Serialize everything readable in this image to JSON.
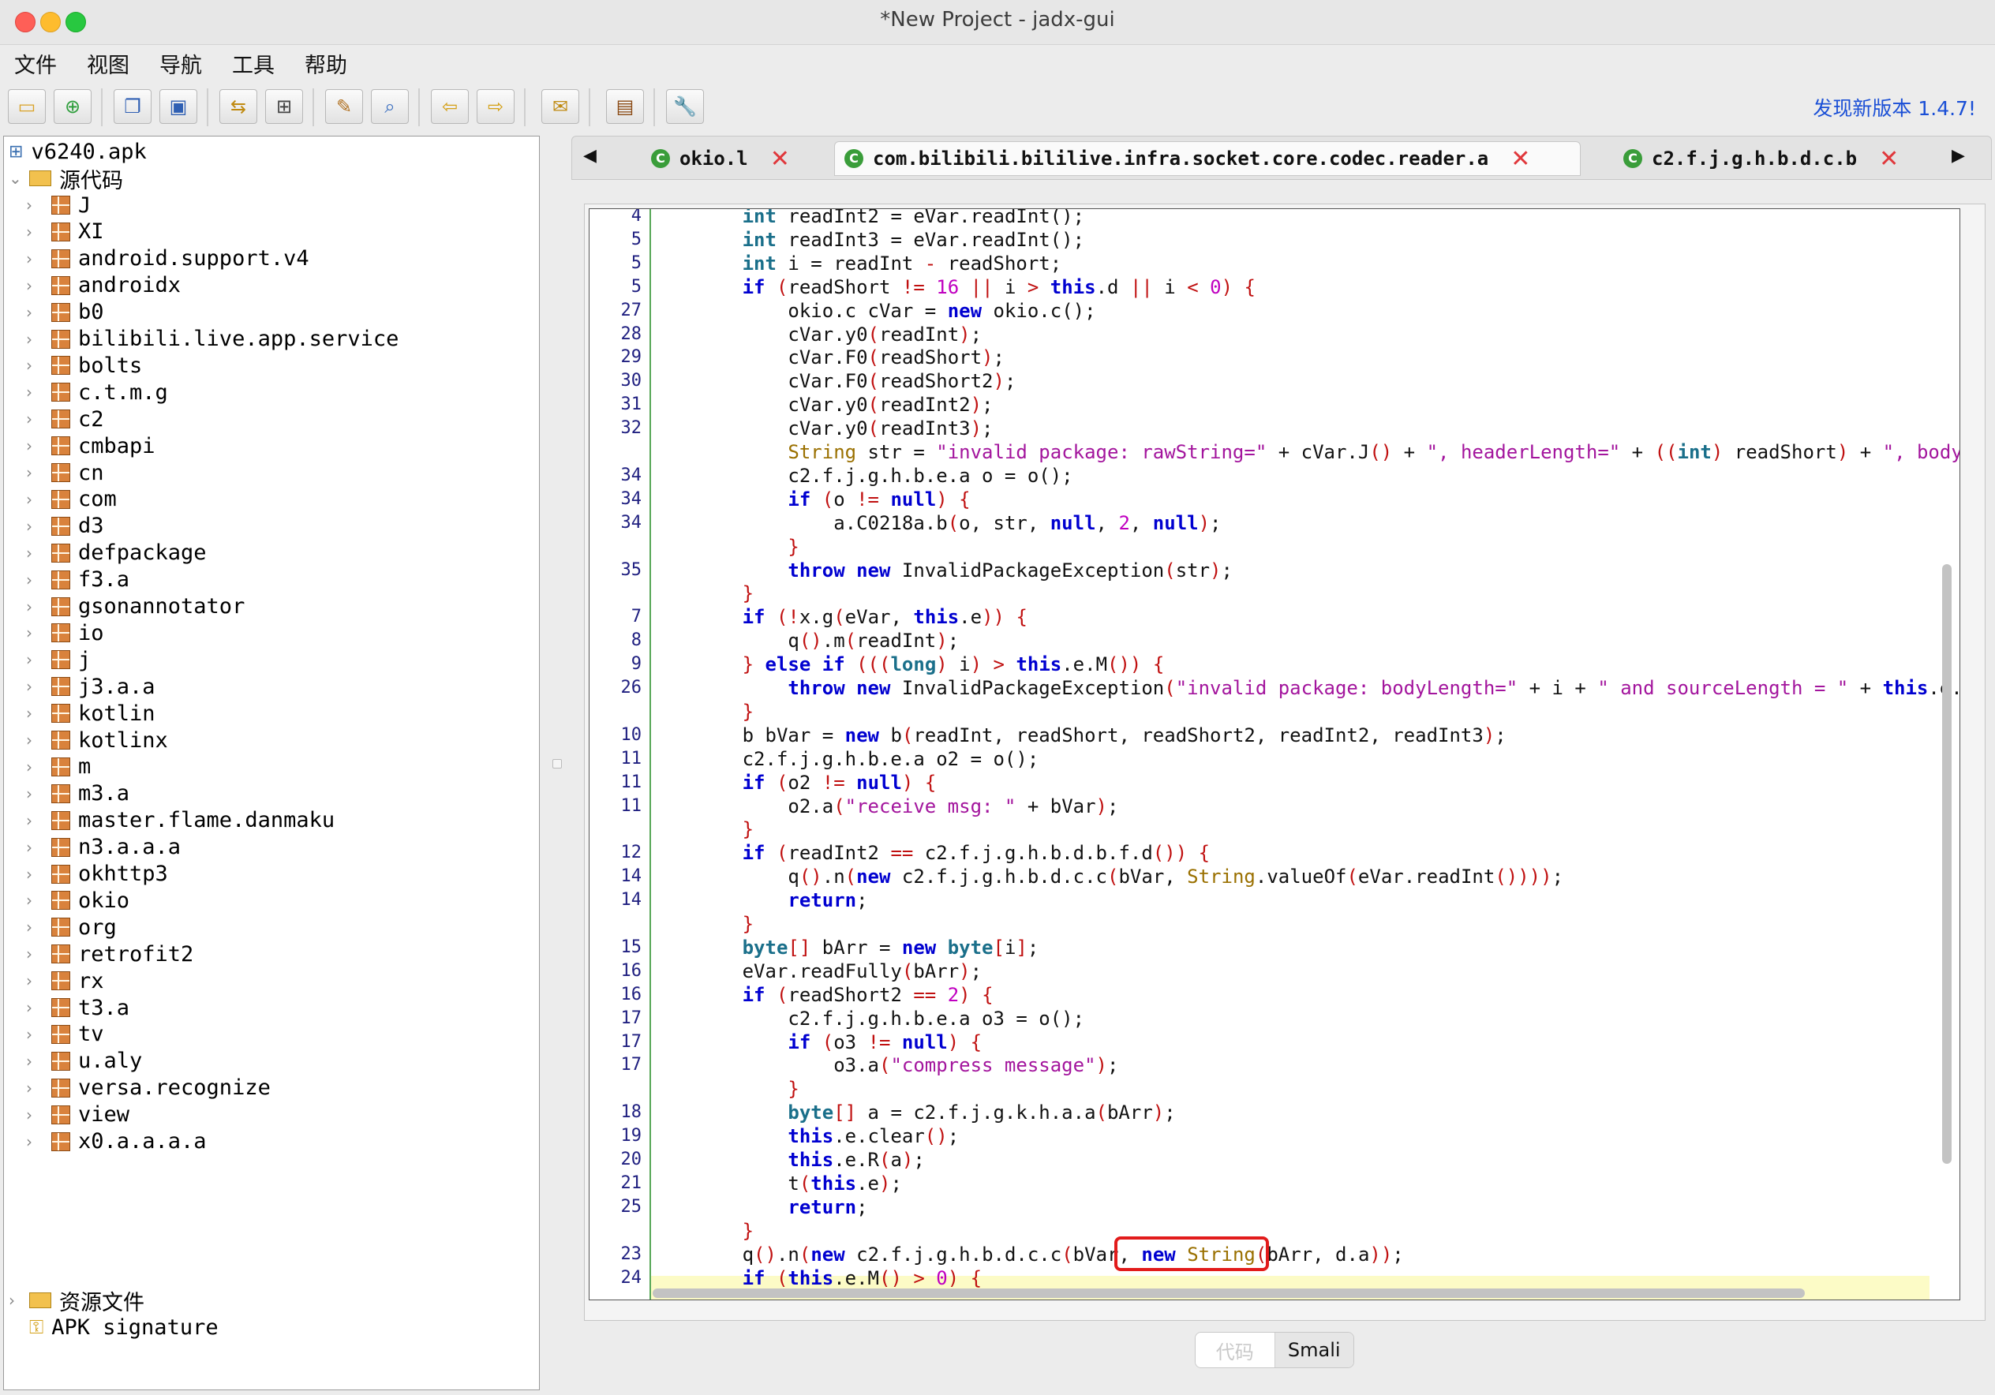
{
  "window": {
    "title": "*New Project - jadx-gui"
  },
  "menu": [
    "文件",
    "视图",
    "导航",
    "工具",
    "帮助"
  ],
  "toolbar": {
    "buttons": [
      "open-file-icon",
      "add-files-icon",
      "copy-icon",
      "save-all-icon",
      "sync-icon",
      "flatten-icon",
      "decompile-wand-icon",
      "search-icon",
      "back-arrow-icon",
      "forward-arrow-icon",
      "preferences-icon",
      "log-viewer-icon",
      "settings-wrench-icon"
    ],
    "update_text": "发现新版本 1.4.7!"
  },
  "tree": {
    "root": "v6240.apk",
    "source_folder": "源代码",
    "packages": [
      "J",
      "XI",
      "android.support.v4",
      "androidx",
      "b0",
      "bilibili.live.app.service",
      "bolts",
      "c.t.m.g",
      "c2",
      "cmbapi",
      "cn",
      "com",
      "d3",
      "defpackage",
      "f3.a",
      "gsonannotator",
      "io",
      "j",
      "j3.a.a",
      "kotlin",
      "kotlinx",
      "m",
      "m3.a",
      "master.flame.danmaku",
      "n3.a.a.a",
      "okhttp3",
      "okio",
      "org",
      "retrofit2",
      "rx",
      "t3.a",
      "tv",
      "u.aly",
      "versa.recognize",
      "view",
      "x0.a.a.a.a"
    ],
    "resources": "资源文件",
    "signature": "APK signature"
  },
  "tabs": [
    {
      "label": "okio.l",
      "icon": "class-c-icon"
    },
    {
      "label": "com.bilibili.bililive.infra.socket.core.codec.reader.a",
      "icon": "class-c-icon",
      "active": true
    },
    {
      "label": "c2.f.j.g.h.b.d.c.b",
      "icon": "class-c-icon"
    }
  ],
  "editor": {
    "line_numbers": [
      "4",
      "5",
      "5",
      "5",
      "27",
      "28",
      "29",
      "30",
      "31",
      "32",
      "",
      "34",
      "34",
      "34",
      "",
      "35",
      "",
      "7",
      "8",
      "9",
      "26",
      "",
      "10",
      "11",
      "11",
      "11",
      "",
      "12",
      "14",
      "14",
      "",
      "15",
      "16",
      "16",
      "17",
      "17",
      "17",
      "",
      "18",
      "19",
      "20",
      "21",
      "25",
      "",
      "23",
      "24"
    ],
    "lines": [
      "        <span class='ty'>int</span> readInt2 = eVar.readInt();",
      "        <span class='ty'>int</span> readInt3 = eVar.readInt();",
      "        <span class='ty'>int</span> i = readInt <span class='op'>-</span> readShort;",
      "        <span class='kw'>if</span> <span class='op'>(</span>readShort <span class='op'>!=</span> <span class='num'>16</span> <span class='op'>||</span> i <span class='op'>&gt;</span> <span class='kw'>this</span>.d <span class='op'>||</span> i <span class='op'>&lt;</span> <span class='num'>0</span><span class='op'>)</span> <span class='op'>{</span>",
      "            okio.c cVar = <span class='kw'>new</span> okio.c();",
      "            cVar.y0<span class='op'>(</span>readInt<span class='op'>)</span>;",
      "            cVar.F0<span class='op'>(</span>readShort<span class='op'>)</span>;",
      "            cVar.F0<span class='op'>(</span>readShort2<span class='op'>)</span>;",
      "            cVar.y0<span class='op'>(</span>readInt2<span class='op'>)</span>;",
      "            cVar.y0<span class='op'>(</span>readInt3<span class='op'>)</span>;",
      "            <span class='cls'>String</span> str = <span class='st'>\"invalid package: rawString=\"</span> + cVar.J<span class='op'>()</span> + <span class='st'>\", headerLength=\"</span> + <span class='op'>((</span><span class='ty'>int</span><span class='op'>)</span> readShort<span class='op'>)</span> + <span class='st'>\", bodyL</span>",
      "            c2.f.j.g.h.b.e.a o = o();",
      "            <span class='kw'>if</span> <span class='op'>(</span>o <span class='op'>!=</span> <span class='kw'>null</span><span class='op'>)</span> <span class='op'>{</span>",
      "                a.C0218a.b<span class='op'>(</span>o, str, <span class='kw'>null</span>, <span class='num'>2</span>, <span class='kw'>null</span><span class='op'>)</span>;",
      "            <span class='op'>}</span>",
      "            <span class='kw'>throw</span> <span class='kw'>new</span> InvalidPackageException<span class='op'>(</span>str<span class='op'>)</span>;",
      "        <span class='op'>}</span>",
      "        <span class='kw'>if</span> <span class='op'>(!</span>x.g<span class='op'>(</span>eVar, <span class='kw'>this</span>.e<span class='op'>))</span> <span class='op'>{</span>",
      "            q<span class='op'>()</span>.m<span class='op'>(</span>readInt<span class='op'>)</span>;",
      "        <span class='op'>}</span> <span class='kw'>else if</span> <span class='op'>(((</span><span class='ty'>long</span><span class='op'>)</span> i<span class='op'>)</span> <span class='op'>&gt;</span> <span class='kw'>this</span>.e.M<span class='op'>())</span> <span class='op'>{</span>",
      "            <span class='kw'>throw</span> <span class='kw'>new</span> InvalidPackageException<span class='op'>(</span><span class='st'>\"invalid package: bodyLength=\"</span> + i + <span class='st'>\" and sourceLength = \"</span> + <span class='kw'>this</span>.e.M",
      "        <span class='op'>}</span>",
      "        b bVar = <span class='kw'>new</span> b<span class='op'>(</span>readInt, readShort, readShort2, readInt2, readInt3<span class='op'>)</span>;",
      "        c2.f.j.g.h.b.e.a o2 = o();",
      "        <span class='kw'>if</span> <span class='op'>(</span>o2 <span class='op'>!=</span> <span class='kw'>null</span><span class='op'>)</span> <span class='op'>{</span>",
      "            o2.a<span class='op'>(</span><span class='st'>\"receive msg: \"</span> + bVar<span class='op'>)</span>;",
      "        <span class='op'>}</span>",
      "        <span class='kw'>if</span> <span class='op'>(</span>readInt2 <span class='op'>==</span> c2.f.j.g.h.b.d.b.f.d<span class='op'>())</span> <span class='op'>{</span>",
      "            q<span class='op'>()</span>.n<span class='op'>(</span><span class='kw'>new</span> c2.f.j.g.h.b.d.c.c<span class='op'>(</span>bVar, <span class='cls'>String</span>.valueOf<span class='op'>(</span>eVar.readInt<span class='op'>())))</span>;",
      "            <span class='kw'>return</span>;",
      "        <span class='op'>}</span>",
      "        <span class='ty'>byte</span><span class='op'>[]</span> bArr = <span class='kw'>new</span> <span class='ty'>byte</span><span class='op'>[</span>i<span class='op'>]</span>;",
      "        eVar.readFully<span class='op'>(</span>bArr<span class='op'>)</span>;",
      "        <span class='kw'>if</span> <span class='op'>(</span>readShort2 <span class='op'>==</span> <span class='num'>2</span><span class='op'>)</span> <span class='op'>{</span>",
      "            c2.f.j.g.h.b.e.a o3 = o();",
      "            <span class='kw'>if</span> <span class='op'>(</span>o3 <span class='op'>!=</span> <span class='kw'>null</span><span class='op'>)</span> <span class='op'>{</span>",
      "                o3.a<span class='op'>(</span><span class='st'>\"compress message\"</span><span class='op'>)</span>;",
      "            <span class='op'>}</span>",
      "            <span class='ty'>byte</span><span class='op'>[]</span> a = c2.f.j.g.k.h.a.a<span class='op'>(</span>bArr<span class='op'>)</span>;",
      "            <span class='kw'>this</span>.e.clear<span class='op'>()</span>;",
      "            <span class='kw'>this</span>.e.R<span class='op'>(</span>a<span class='op'>)</span>;",
      "            t<span class='op'>(</span><span class='kw'>this</span>.e<span class='op'>)</span>;",
      "            <span class='kw'>return</span>;",
      "        <span class='op'>}</span>",
      "        q<span class='op'>()</span>.n<span class='op'>(</span><span class='kw'>new</span> c2.f.j.g.h.b.d.c.c<span class='op'>(</span>bVar, <span class='kw'>new</span> <span class='cls'>String</span><span class='op'>(</span>bArr, d.a<span class='op'>))</span>;",
      "        <span class='kw'>if</span> <span class='op'>(</span><span class='kw'>this</span>.e.M<span class='op'>()</span> <span class='op'>&gt;</span> <span class='num'>0</span><span class='op'>)</span> <span class='op'>{</span>"
    ]
  },
  "bottom_tabs": [
    "代码",
    "Smali"
  ]
}
